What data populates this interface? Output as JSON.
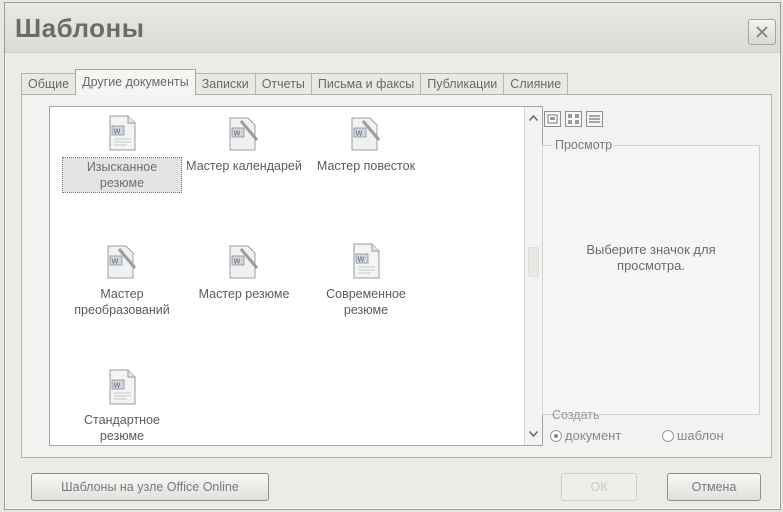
{
  "window": {
    "title": "Шаблоны"
  },
  "tabs": [
    {
      "label": "Общие",
      "active": false
    },
    {
      "label": "Другие документы",
      "active": true
    },
    {
      "label": "Записки",
      "active": false
    },
    {
      "label": "Отчеты",
      "active": false
    },
    {
      "label": "Письма и факсы",
      "active": false
    },
    {
      "label": "Публикации",
      "active": false
    },
    {
      "label": "Слияние",
      "active": false
    }
  ],
  "templates": [
    {
      "label": "Изысканное резюме",
      "icon": "word-document-icon",
      "selected": true
    },
    {
      "label": "Мастер календарей",
      "icon": "word-wizard-icon",
      "selected": false
    },
    {
      "label": "Мастер повесток",
      "icon": "word-wizard-icon",
      "selected": false
    },
    {
      "label": "Мастер преобразований",
      "icon": "word-wizard-icon",
      "selected": false
    },
    {
      "label": "Мастер резюме",
      "icon": "word-wizard-icon",
      "selected": false
    },
    {
      "label": "Современное резюме",
      "icon": "word-document-icon",
      "selected": false
    },
    {
      "label": "Стандартное резюме",
      "icon": "word-document-icon",
      "selected": false
    }
  ],
  "preview": {
    "legend": "Просмотр",
    "message": "Выберите значок для просмотра."
  },
  "create": {
    "legend": "Создать",
    "option_document": "документ",
    "option_template": "шаблон",
    "selected": "document"
  },
  "buttons": {
    "online": "Шаблоны на узле Office Online",
    "ok": "ОК",
    "cancel": "Отмена"
  },
  "icons": [
    "close-icon",
    "large-icons-view-icon",
    "list-view-icon",
    "details-view-icon",
    "scroll-up-icon",
    "scroll-down-icon"
  ]
}
